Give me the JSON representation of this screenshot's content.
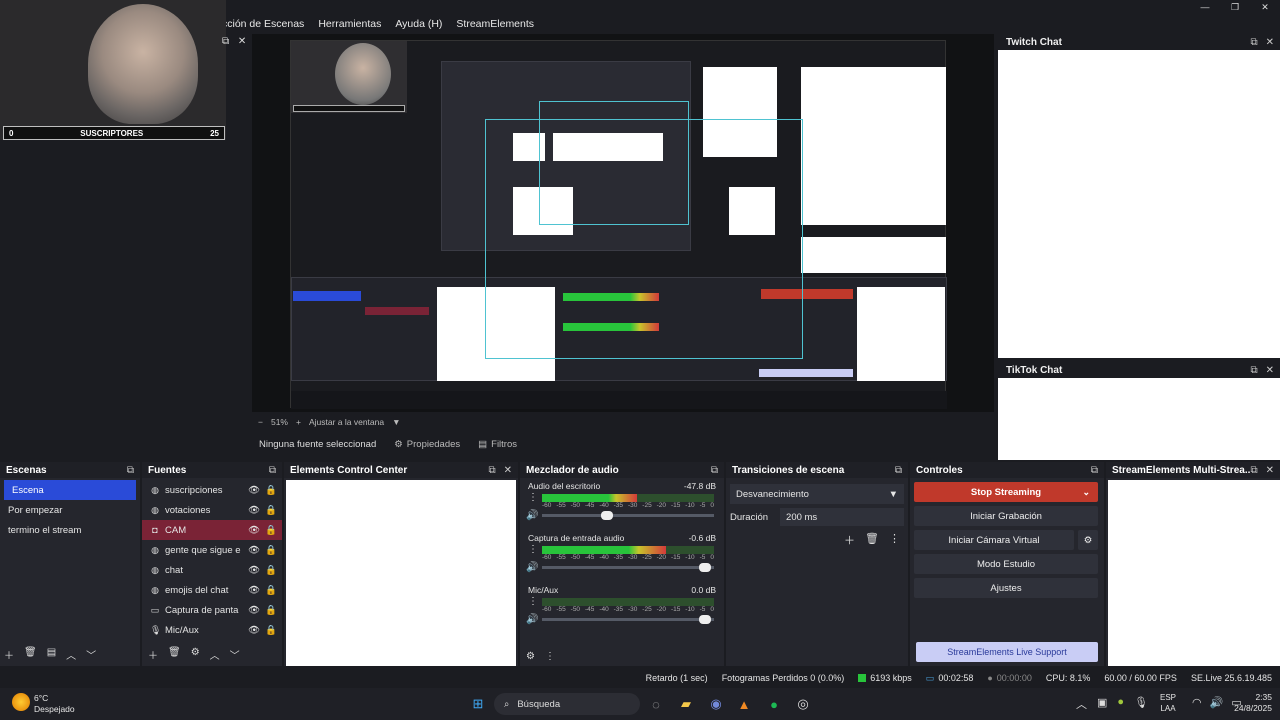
{
  "menu": {
    "items": [
      "cción de Escenas",
      "Herramientas",
      "Ayuda (H)",
      "StreamElements"
    ]
  },
  "window_controls": [
    "—",
    "❐",
    "✕"
  ],
  "cam_overlay": {
    "left_count": "0",
    "label": "SUSCRIPTORES",
    "right_count": "25"
  },
  "docks_side": {
    "twitch_title": "Twitch Chat",
    "tiktok_title": "TikTok Chat"
  },
  "preview": {
    "zoom": "51%",
    "fit": "Ajustar a la ventana",
    "no_source": "Ninguna fuente seleccionad",
    "properties": "Propiedades",
    "filters": "Filtros"
  },
  "scenes": {
    "title": "Escenas",
    "items": [
      "Escena",
      "Por empezar",
      "termino el stream"
    ]
  },
  "sources": {
    "title": "Fuentes",
    "items": [
      {
        "label": "suscripciones",
        "icon": "globe-icon"
      },
      {
        "label": "votaciones",
        "icon": "globe-icon"
      },
      {
        "label": "CAM",
        "icon": "camera-icon"
      },
      {
        "label": "gente que sigue e",
        "icon": "globe-icon"
      },
      {
        "label": "chat",
        "icon": "globe-icon"
      },
      {
        "label": "emojis del chat",
        "icon": "globe-icon"
      },
      {
        "label": "Captura de panta",
        "icon": "monitor-icon"
      },
      {
        "label": "Mic/Aux",
        "icon": "mic-icon"
      }
    ]
  },
  "ecc": {
    "title": "Elements Control Center"
  },
  "mixer": {
    "title": "Mezclador de audio",
    "ticks": [
      "-60",
      "-55",
      "-50",
      "-45",
      "-40",
      "-35",
      "-30",
      "-25",
      "-20",
      "-15",
      "-10",
      "-5",
      "0"
    ],
    "channels": [
      {
        "name": "Audio del escritorio",
        "db": "-47.8 dB",
        "level": 0.55,
        "volume": 0.38
      },
      {
        "name": "Captura de entrada audio",
        "db": "-0.6 dB",
        "level": 0.72,
        "volume": 0.95
      },
      {
        "name": "Mic/Aux",
        "db": "0.0 dB",
        "level": 0.0,
        "volume": 0.95
      }
    ]
  },
  "transitions": {
    "title": "Transiciones de escena",
    "selected": "Desvanecimiento",
    "duration_label": "Duración",
    "duration_value": "200 ms"
  },
  "controls": {
    "title": "Controles",
    "stop_streaming": "Stop Streaming",
    "start_recording": "Iniciar Grabación",
    "virtual_cam": "Iniciar Cámara Virtual",
    "studio_mode": "Modo Estudio",
    "settings": "Ajustes",
    "live_support": "StreamElements Live Support"
  },
  "multistream": {
    "title": "StreamElements Multi-Strea..."
  },
  "status": {
    "delay": "Retardo (1 sec)",
    "dropped": "Fotogramas Perdidos 0 (0.0%)",
    "kbps": "6193 kbps",
    "live_time": "00:02:58",
    "rec_time": "00:00:00",
    "cpu": "CPU: 8.1%",
    "fps": "60.00 / 60.00 FPS",
    "version": "SE.Live 25.6.19.485"
  },
  "taskbar": {
    "weather_temp": "6°C",
    "weather_desc": "Despejado",
    "search": "Búsqueda",
    "lang_top": "ESP",
    "lang_bottom": "LAA",
    "time": "2:35",
    "date": "24/8/2025"
  },
  "colors": {
    "scene_selected": "#2a4bd8",
    "source_selected": "#7a2336",
    "stop_streaming": "#c0392b",
    "live_support": "#c9cdf5",
    "guide_rect": "#4fc3d1"
  }
}
